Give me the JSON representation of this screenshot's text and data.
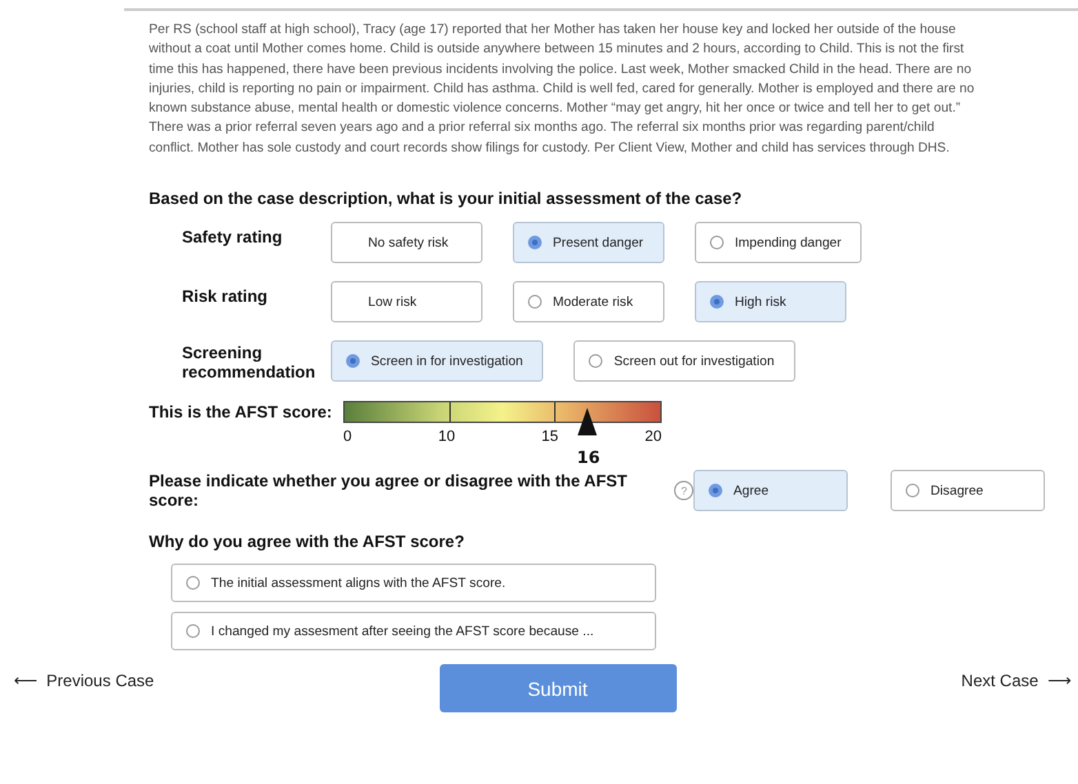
{
  "case_description": "Per RS (school staff at high school), Tracy (age 17) reported that her Mother has taken her house key and locked her outside of the house without a coat until Mother comes home. Child is outside anywhere between 15 minutes and 2 hours, according to Child. This is not the first time this has happened, there have been previous incidents involving the police. Last week, Mother smacked Child in the head. There are no injuries, child is reporting no pain or impairment. Child has asthma. Child is well fed, cared for generally. Mother is employed and there are no known substance abuse, mental health or domestic violence concerns. Mother “may get angry, hit her once or twice and tell her to get out.” There was a prior referral seven years ago and a prior referral six months ago. The referral six months prior was regarding parent/child conflict. Mother has sole custody and court records show filings for custody. Per Client View, Mother and child has services through DHS.",
  "assessment_question": "Based on the case description, what is your initial assessment of the case?",
  "ratings": [
    {
      "label": "Safety rating",
      "options": [
        {
          "label": "No safety risk",
          "kind": "plain",
          "selected": false
        },
        {
          "label": "Present danger",
          "kind": "radio",
          "selected": true
        },
        {
          "label": "Impending danger",
          "kind": "radio",
          "selected": false
        }
      ]
    },
    {
      "label": "Risk rating",
      "options": [
        {
          "label": "Low risk",
          "kind": "plain",
          "selected": false
        },
        {
          "label": "Moderate risk",
          "kind": "radio",
          "selected": false
        },
        {
          "label": "High risk",
          "kind": "radio",
          "selected": true
        }
      ]
    },
    {
      "label": "Screening recommendation",
      "options": [
        {
          "label": "Screen in for investigation",
          "kind": "radio",
          "selected": true
        },
        {
          "label": "Screen out for investigation",
          "kind": "radio",
          "selected": false
        }
      ]
    }
  ],
  "afst": {
    "label": "This is the AFST score:",
    "ticks": [
      "0",
      "10",
      "15",
      "20"
    ],
    "score": "16",
    "level": 0.77
  },
  "agree_question": {
    "label": "Please indicate whether you agree or disagree with the AFST score:",
    "help": "?",
    "options": [
      {
        "label": "Agree",
        "selected": true
      },
      {
        "label": "Disagree",
        "selected": false
      }
    ]
  },
  "why_question": {
    "label": "Why do you agree with the AFST score?",
    "options": [
      {
        "label": "The initial assessment aligns with the AFST score.",
        "selected": false
      },
      {
        "label": "I changed my assesment after seeing the AFST score because ...",
        "selected": false
      }
    ]
  },
  "nav": {
    "previous": {
      "arrow": "⟵",
      "label": "Previous Case"
    },
    "submit": "Submit",
    "next": {
      "arrow": "⟶",
      "label": "Next Case"
    }
  }
}
